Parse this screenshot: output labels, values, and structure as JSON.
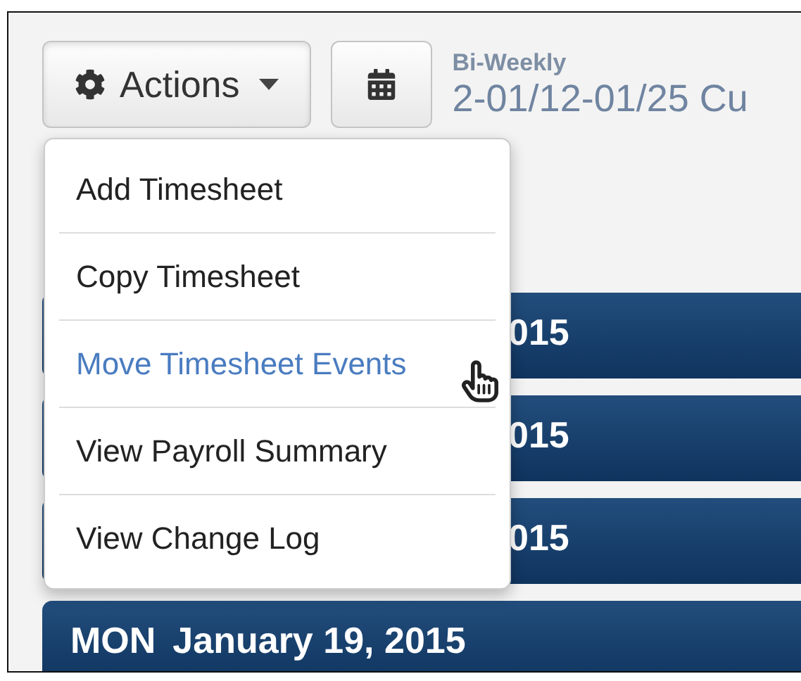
{
  "toolbar": {
    "actions_button": {
      "label": "Actions",
      "expanded": true
    },
    "period": {
      "frequency": "Bi-Weekly",
      "range": "2-01/12-01/25 Cu"
    }
  },
  "actions_menu": [
    {
      "label": "Add Timesheet",
      "selected": false
    },
    {
      "label": "Copy Timesheet",
      "selected": false
    },
    {
      "label": "Move Timesheet Events",
      "selected": true
    },
    {
      "label": "View Payroll Summary",
      "selected": false
    },
    {
      "label": "View Change Log",
      "selected": false
    }
  ],
  "day_bars": [
    {
      "kind": "partial",
      "date": "015"
    },
    {
      "kind": "partial",
      "date": "015"
    },
    {
      "kind": "partial",
      "date": "015"
    },
    {
      "kind": "full",
      "weekday": "MON",
      "date": "January 19, 2015"
    }
  ]
}
